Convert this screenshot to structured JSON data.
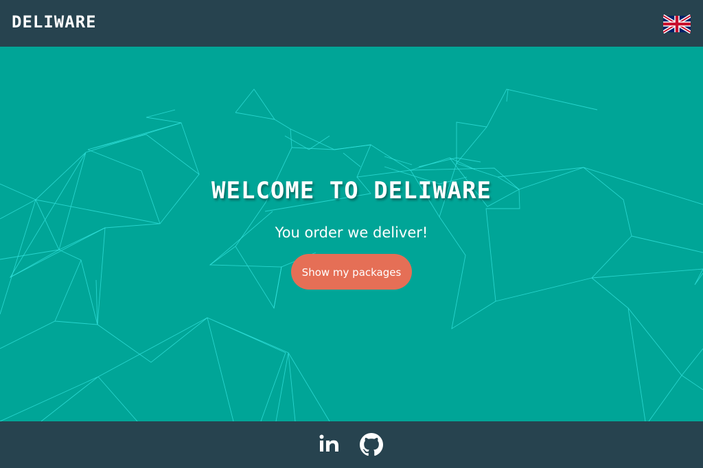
{
  "header": {
    "brand": "DELIWARE",
    "language_icon": "uk-flag-icon"
  },
  "hero": {
    "title": "WELCOME TO DELIWARE",
    "subtitle": "You order we deliver!",
    "cta_label": "Show my packages"
  },
  "footer": {
    "links": [
      {
        "icon": "linkedin-icon",
        "label": "in"
      },
      {
        "icon": "github-icon"
      }
    ]
  },
  "colors": {
    "navbar": "#27434f",
    "hero_background": "#00a597",
    "network_lines": "#35e6e0",
    "cta_background": "#e56f56",
    "text": "#ffffff"
  }
}
